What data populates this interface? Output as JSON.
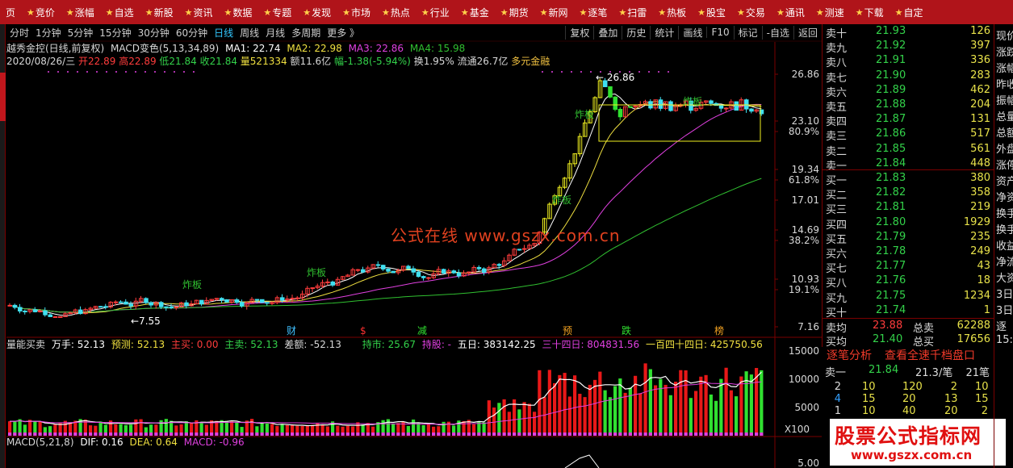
{
  "topbar": {
    "first": "页",
    "items": [
      "竞价",
      "涨幅",
      "自选",
      "新股",
      "资讯",
      "数据",
      "专题",
      "发现",
      "市场",
      "热点",
      "行业",
      "基金",
      "期货",
      "新网",
      "逐笔",
      "扫雷",
      "热板",
      "股宝",
      "交易",
      "通讯",
      "测速",
      "下载",
      "自定"
    ]
  },
  "periods": {
    "tabs": [
      "分时",
      "1分钟",
      "5分钟",
      "15分钟",
      "30分钟",
      "60分钟",
      "日线",
      "周线",
      "月线",
      "多周期",
      "更多 》"
    ],
    "active": "日线",
    "tools": [
      "复权",
      "叠加",
      "历史",
      "统计",
      "画线",
      "F10",
      "标记",
      "-自选",
      "返回"
    ]
  },
  "header": {
    "stock": "越秀金控(日线,前复权)",
    "indicator": "MACD变色(5,13,34,89)",
    "ma1": "MA1: 22.74",
    "ma2": "MA2: 22.98",
    "ma3": "MA3: 22.86",
    "ma4": "MA4: 15.98",
    "date": "2020/08/26/三",
    "open": "开22.89",
    "high": "高22.89",
    "low": "低21.84",
    "close": "收21.84",
    "vol": "量521334",
    "amount": "额11.6亿",
    "change": "幅-1.38(-5.94%)",
    "turnover": "换1.95%",
    "float": "流通26.7亿",
    "concept": "多元金融"
  },
  "price_axis": {
    "labels": [
      "26.86",
      "23.10",
      "80.9%",
      "19.34",
      "61.8%",
      "17.01",
      "14.69",
      "38.2%",
      "10.93",
      "19.1%",
      "7.16"
    ],
    "high_mark": "26.86",
    "low_mark": "7.55"
  },
  "chart_labels": {
    "zhaban": "炸板",
    "cai": "财",
    "s": "$",
    "jian": "减",
    "yu": "预",
    "die": "跌",
    "bang": "榜"
  },
  "watermark": "公式在线  www.gszx.com.cn",
  "volume": {
    "title": "量能买卖",
    "wanshou": "万手: 52.13",
    "yuce": "预测: 52.13",
    "zhumai": "主买: 0.00",
    "zhumai2": "主卖: 52.13",
    "chae": "差额: -52.13",
    "chishi": "持市: 25.67",
    "chigu": "持股: -",
    "wuri": "五日: 383142.25",
    "sanshisi": "三十四日: 804831.56",
    "yibai": "一百四十四日: 425750.56",
    "axis": [
      "15000",
      "10000",
      "5000",
      "X100"
    ]
  },
  "macd": {
    "title": "MACD(5,21,8)",
    "dif": "DIF: 0.16",
    "dea": "DEA: 0.64",
    "macd": "MACD: -0.96",
    "axis": "5.00"
  },
  "orderbook": {
    "asks": [
      {
        "name": "卖十",
        "price": "21.93",
        "vol": "126"
      },
      {
        "name": "卖九",
        "price": "21.92",
        "vol": "397"
      },
      {
        "name": "卖八",
        "price": "21.91",
        "vol": "336"
      },
      {
        "name": "卖七",
        "price": "21.90",
        "vol": "283"
      },
      {
        "name": "卖六",
        "price": "21.89",
        "vol": "462"
      },
      {
        "name": "卖五",
        "price": "21.88",
        "vol": "204"
      },
      {
        "name": "卖四",
        "price": "21.87",
        "vol": "131"
      },
      {
        "name": "卖三",
        "price": "21.86",
        "vol": "517"
      },
      {
        "name": "卖二",
        "price": "21.85",
        "vol": "561"
      },
      {
        "name": "卖一",
        "price": "21.84",
        "vol": "448"
      }
    ],
    "bids": [
      {
        "name": "买一",
        "price": "21.83",
        "vol": "380"
      },
      {
        "name": "买二",
        "price": "21.82",
        "vol": "358"
      },
      {
        "name": "买三",
        "price": "21.81",
        "vol": "219"
      },
      {
        "name": "买四",
        "price": "21.80",
        "vol": "1929"
      },
      {
        "name": "买五",
        "price": "21.79",
        "vol": "235"
      },
      {
        "name": "买六",
        "price": "21.78",
        "vol": "249"
      },
      {
        "name": "买七",
        "price": "21.77",
        "vol": "43"
      },
      {
        "name": "买八",
        "price": "21.76",
        "vol": "18"
      },
      {
        "name": "买九",
        "price": "21.75",
        "vol": "1234"
      },
      {
        "name": "买十",
        "price": "21.74",
        "vol": "1"
      }
    ],
    "avg_ask_label": "卖均",
    "avg_ask": "23.88",
    "total_ask_label": "总卖",
    "total_ask": "62288",
    "avg_bid_label": "买均",
    "avg_bid": "21.40",
    "total_bid_label": "总买",
    "total_bid": "17656"
  },
  "analysis": {
    "tab1": "逐笔分析",
    "tab2": "查看全速千档盘口",
    "sell1_label": "卖一",
    "sell1_price": "21.84",
    "per_trade": "21.3/笔",
    "count": "21笔",
    "rows": [
      [
        "2",
        "10",
        "120",
        "2",
        "10"
      ],
      [
        "4",
        "15",
        "20",
        "13",
        "15"
      ],
      [
        "1",
        "10",
        "40",
        "20",
        "2"
      ]
    ]
  },
  "promo": {
    "title": "股票公式指标网",
    "url": "www.gszx.com.cn"
  },
  "rightcol": [
    "现价",
    "涨跌",
    "涨幅",
    "昨收",
    "振幅",
    "总量",
    "总额",
    "外盘",
    "涨停",
    "资产",
    "净资",
    "换手",
    "换手",
    "收益",
    "净流",
    "大资",
    "3日",
    "3日",
    "逐",
    "15:0"
  ],
  "colors": {
    "up": "#ff3c3c",
    "down": "#40e0f0",
    "ma1": "#ffffff",
    "ma2": "#f0e040",
    "ma3": "#e040e0",
    "ma4": "#30c030",
    "bid_green": "#33d24a",
    "topbar": "#b0141a"
  }
}
